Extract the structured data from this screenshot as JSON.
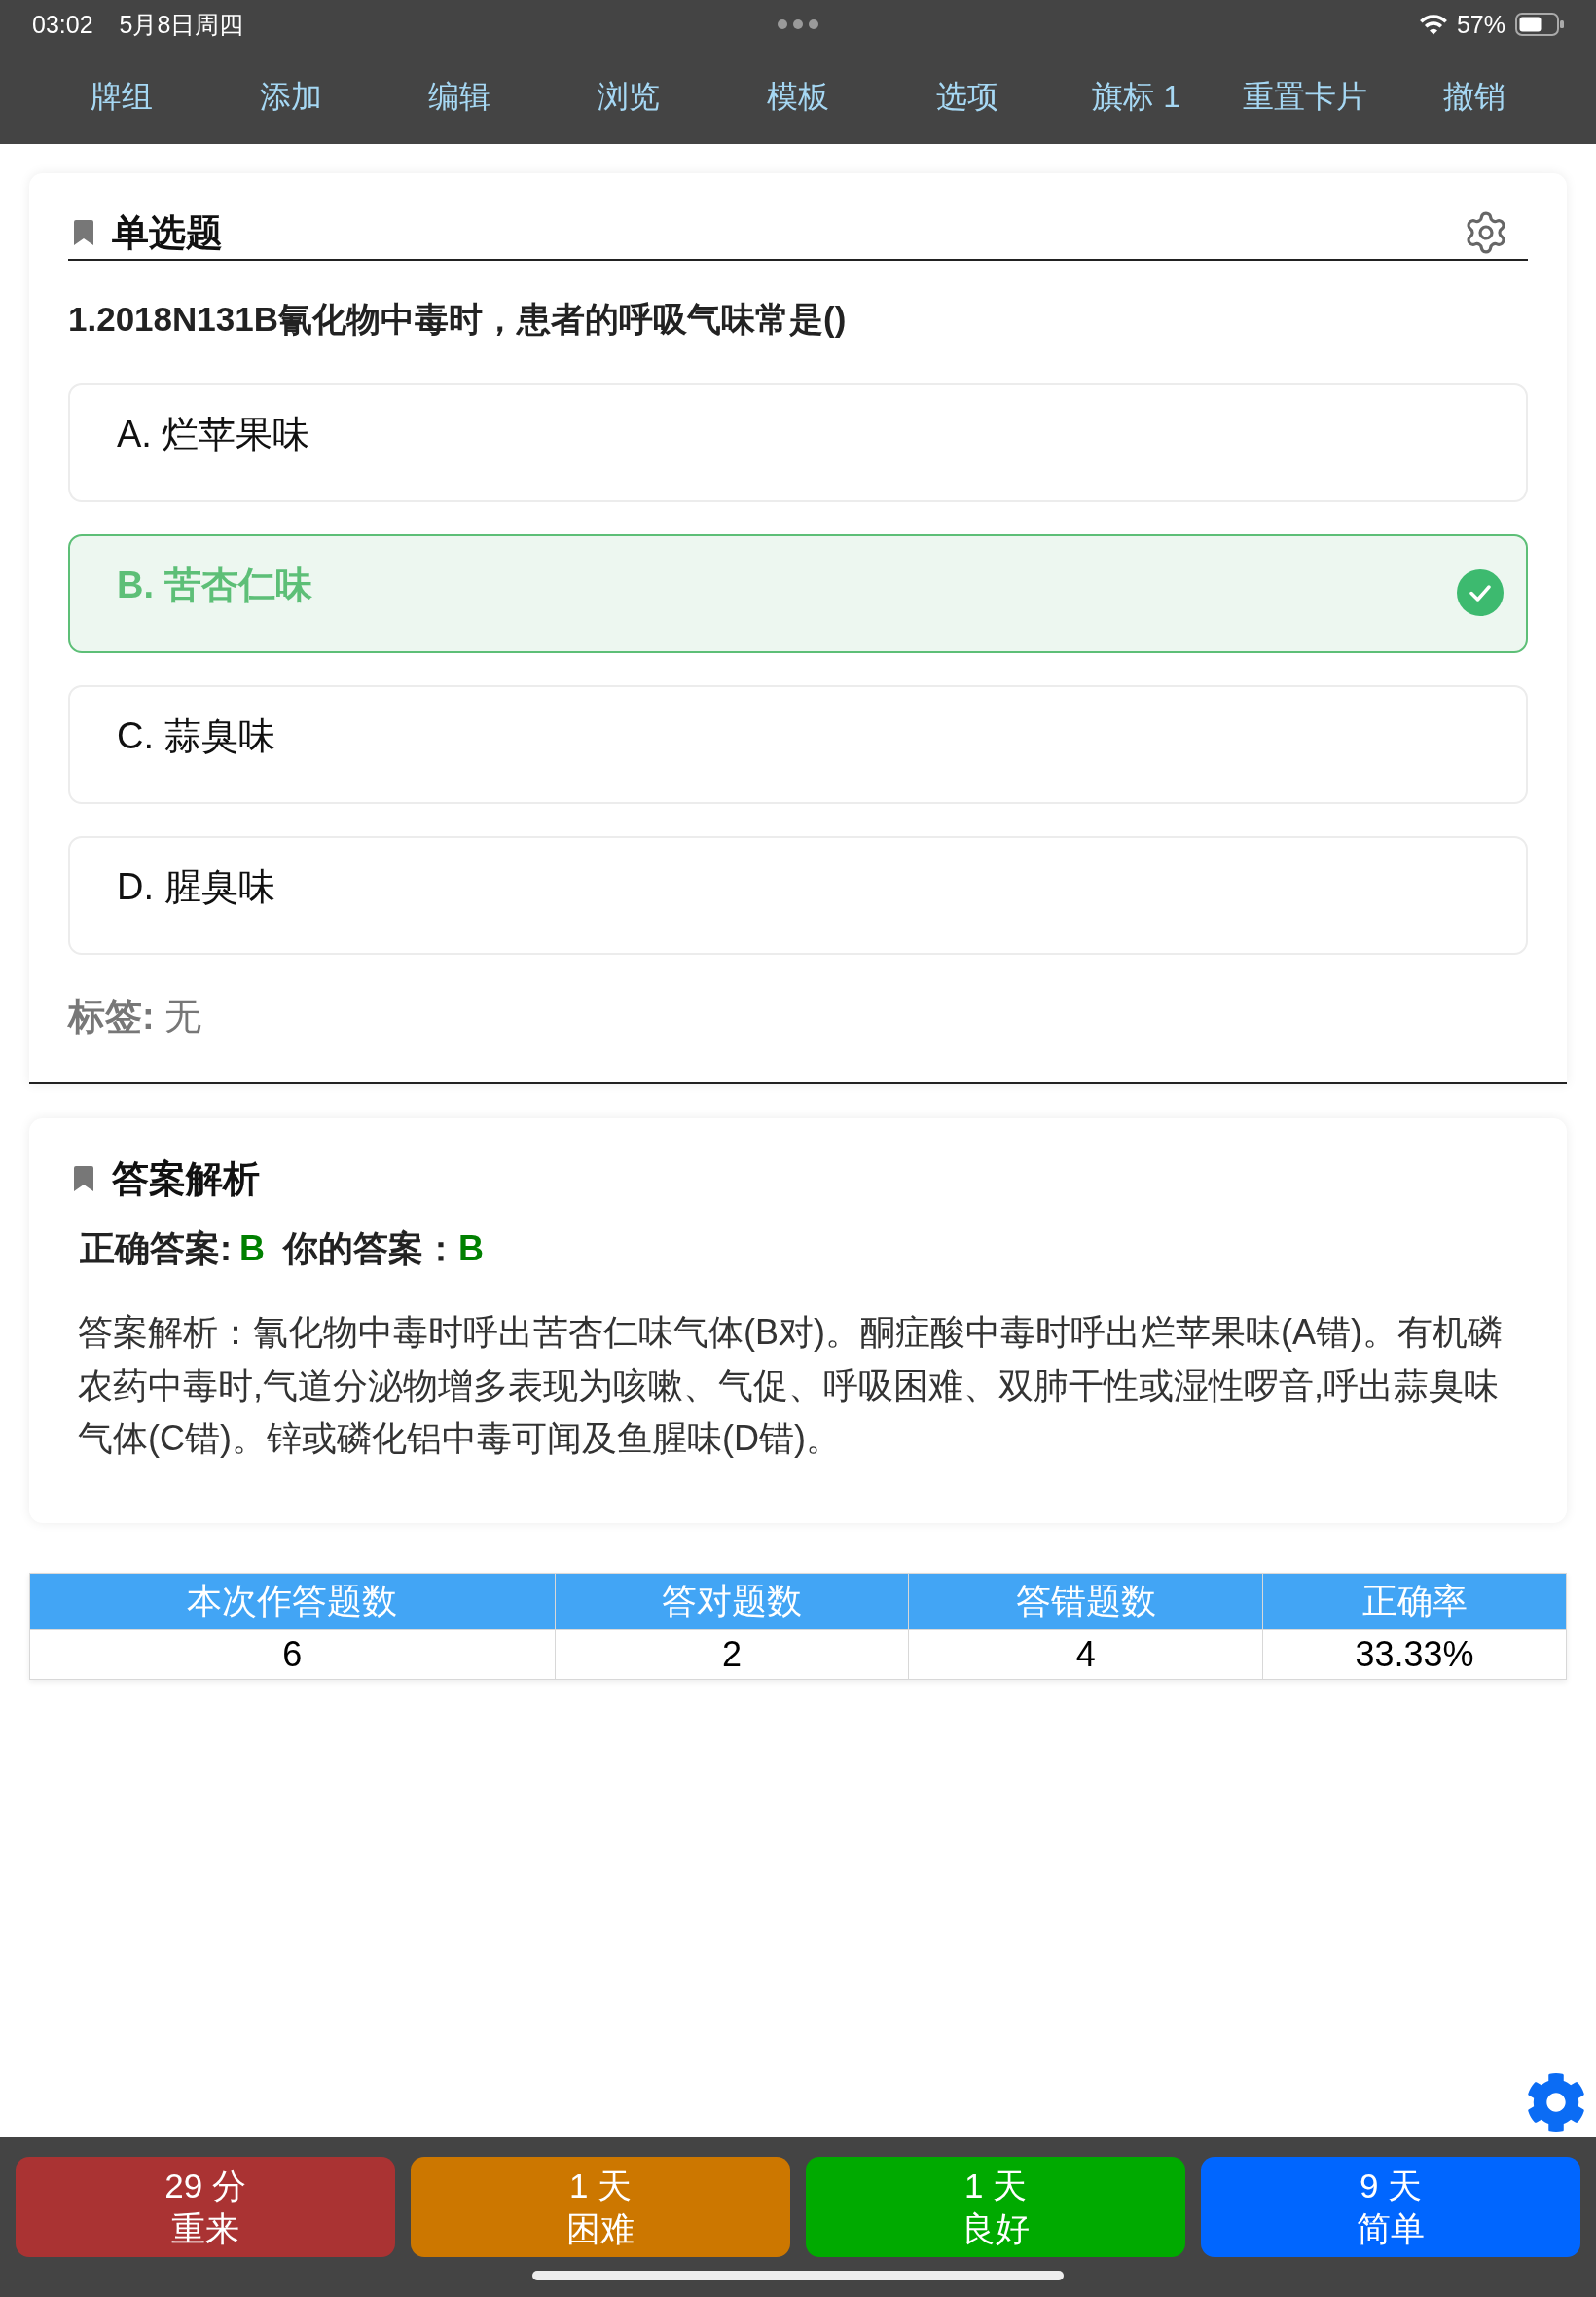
{
  "status_bar": {
    "time": "03:02",
    "date": "5月8日周四",
    "battery_percent": "57%"
  },
  "toolbar": [
    "牌组",
    "添加",
    "编辑",
    "浏览",
    "模板",
    "选项",
    "旗标 1",
    "重置卡片",
    "撤销"
  ],
  "question_card": {
    "type_label": "单选题",
    "question": "1.2018N131B氰化物中毒时，患者的呼吸气味常是()",
    "options": [
      {
        "label": "A. 烂苹果味",
        "selected": false
      },
      {
        "label": "B. 苦杏仁味",
        "selected": true
      },
      {
        "label": "C. 蒜臭味",
        "selected": false
      },
      {
        "label": "D. 腥臭味",
        "selected": false
      }
    ],
    "tags_label": "标签:",
    "tags_value": "无"
  },
  "analysis_card": {
    "title": "答案解析",
    "correct_label": "正确答案:",
    "correct_value": "B",
    "your_label": "你的答案：",
    "your_value": "B",
    "explanation": "答案解析：氰化物中毒时呼出苦杏仁味气体(B对)。酮症酸中毒时呼出烂苹果味(A错)。有机磷农药中毒时,气道分泌物增多表现为咳嗽、气促、呼吸困难、双肺干性或湿性啰音,呼出蒜臭味气体(C错)。锌或磷化铝中毒可闻及鱼腥味(D错)。"
  },
  "stats_table": {
    "columns": [
      "本次作答题数",
      "答对题数",
      "答错题数",
      "正确率"
    ],
    "rows": [
      [
        "6",
        "2",
        "4",
        "33.33%"
      ]
    ]
  },
  "answer_buttons": [
    {
      "interval": "29 分",
      "label": "重来",
      "color": "#aa3333"
    },
    {
      "interval": "1 天",
      "label": "困难",
      "color": "#cc7700"
    },
    {
      "interval": "1 天",
      "label": "良好",
      "color": "#00aa00"
    },
    {
      "interval": "9 天",
      "label": "简单",
      "color": "#0066ff"
    }
  ]
}
